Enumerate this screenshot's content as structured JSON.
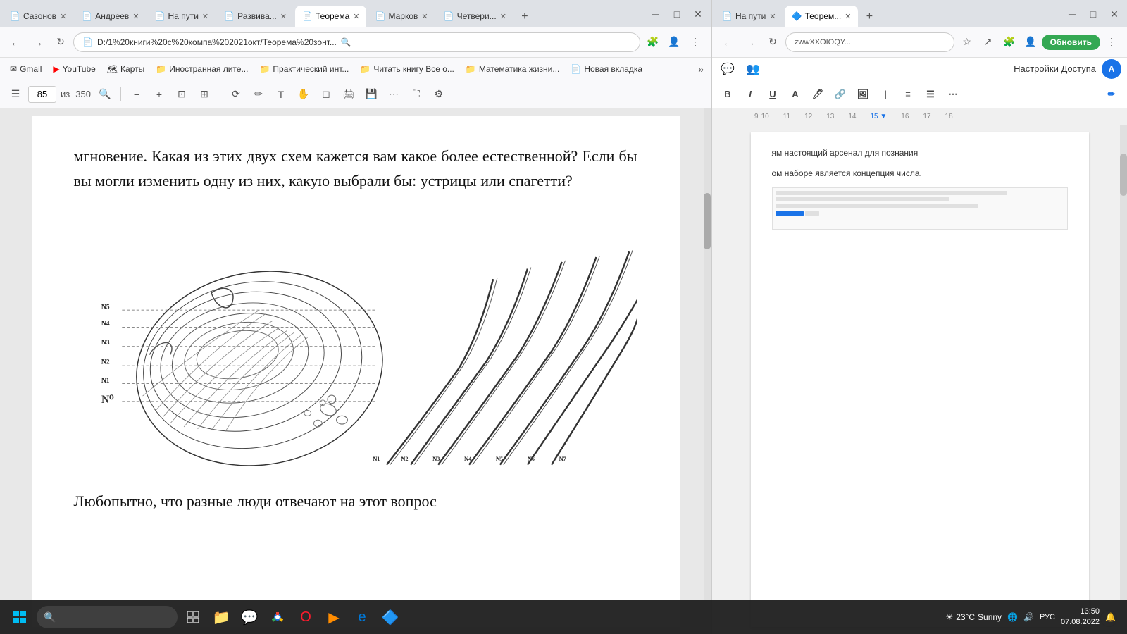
{
  "browser_left": {
    "tabs": [
      {
        "label": "Сазонов",
        "active": false,
        "icon": "📄"
      },
      {
        "label": "Андреев",
        "active": false,
        "icon": "📄"
      },
      {
        "label": "На пути",
        "active": false,
        "icon": "📄"
      },
      {
        "label": "Развива...",
        "active": false,
        "icon": "📄"
      },
      {
        "label": "Теорема",
        "active": true,
        "icon": "📄"
      },
      {
        "label": "Марков",
        "active": false,
        "icon": "📄"
      },
      {
        "label": "Четвери...",
        "active": false,
        "icon": "📄"
      }
    ],
    "address": "D:/1%20книги%20с%20компа%202021окт/Теорема%20зонт...",
    "bookmarks": [
      {
        "label": "Gmail",
        "icon": "✉"
      },
      {
        "label": "YouTube",
        "icon": "▶"
      },
      {
        "label": "Карты",
        "icon": "🗺"
      },
      {
        "label": "Иностранная лите...",
        "icon": "📁"
      },
      {
        "label": "Практический инт...",
        "icon": "📁"
      },
      {
        "label": "Читать книгу Все о...",
        "icon": "📁"
      },
      {
        "label": "Математика жизни...",
        "icon": "📁"
      },
      {
        "label": "Новая вкладка",
        "icon": "📁"
      }
    ],
    "pdf_toolbar": {
      "page_current": "85",
      "page_total": "350"
    },
    "pdf_text_top": "мгновение. Какая из этих двух схем кажется вам какое более естественной? Если бы вы могли изменить одну из них, какую выбрали бы: устрицы или спагетти?",
    "pdf_text_bottom": "Любопытно, что разные люди отвечают на этот вопрос"
  },
  "browser_right": {
    "tabs": [
      {
        "label": "На пути",
        "active": false,
        "icon": "📄"
      },
      {
        "label": "Теорем...",
        "active": true,
        "icon": "🟦"
      }
    ],
    "address": "zwwXXOIOQY...",
    "header_label": "Настройки Доступа",
    "gdocs_text_1": "ям настоящий арсенал для познания",
    "gdocs_text_2": "ом наборе является концепция числа."
  },
  "taskbar": {
    "start_icon": "⊞",
    "search_placeholder": "🔍",
    "time": "13:50",
    "date": "07.08.2022",
    "temperature": "23°C",
    "weather": "Sunny",
    "lang": "РУС"
  }
}
